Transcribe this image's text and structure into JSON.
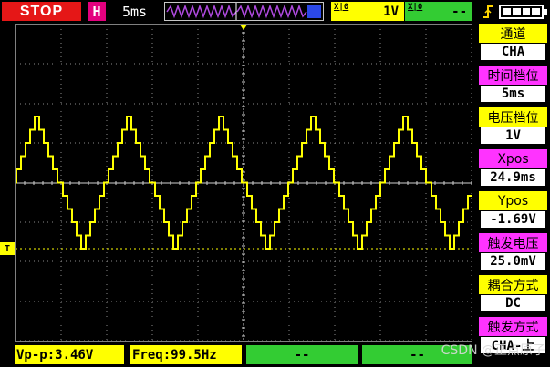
{
  "header": {
    "status": "STOP",
    "horizontal_label": "H",
    "time_base": "5ms",
    "trigger_channel_icon": "X|0",
    "trigger_channel_value": "1V",
    "channel2_icon": "X|0",
    "channel2_value": "--",
    "trigger_mode_icon": "edge-trigger-icon",
    "battery_icon": "battery-icon"
  },
  "trigger_marker": "T",
  "side_panel": [
    {
      "label": "通道",
      "value": "CHA",
      "label_color": "#ffff00"
    },
    {
      "label": "时间档位",
      "value": "5ms",
      "label_color": "#ff33ff"
    },
    {
      "label": "电压档位",
      "value": "1V",
      "label_color": "#ffff00"
    },
    {
      "label": "Xpos",
      "value": "24.9ms",
      "label_color": "#ff33ff"
    },
    {
      "label": "Ypos",
      "value": "-1.69V",
      "label_color": "#ffff00"
    },
    {
      "label": "触发电压",
      "value": "25.0mV",
      "label_color": "#ff33ff"
    },
    {
      "label": "耦合方式",
      "value": "DC",
      "label_color": "#ffff00"
    },
    {
      "label": "触发方式",
      "value": "CHA-上",
      "label_color": "#ff33ff"
    }
  ],
  "measurements": {
    "vpp": "Vp-p:3.46V",
    "freq": "Freq:99.5Hz",
    "slot3": "--",
    "slot4": "--"
  },
  "watermark": "CSDN @正点原子",
  "colors": {
    "trace": "#ffff00",
    "grid": "#8a8a8a",
    "stop": "#e51717",
    "accent_magenta": "#e3007e",
    "green": "#33cc33"
  }
}
